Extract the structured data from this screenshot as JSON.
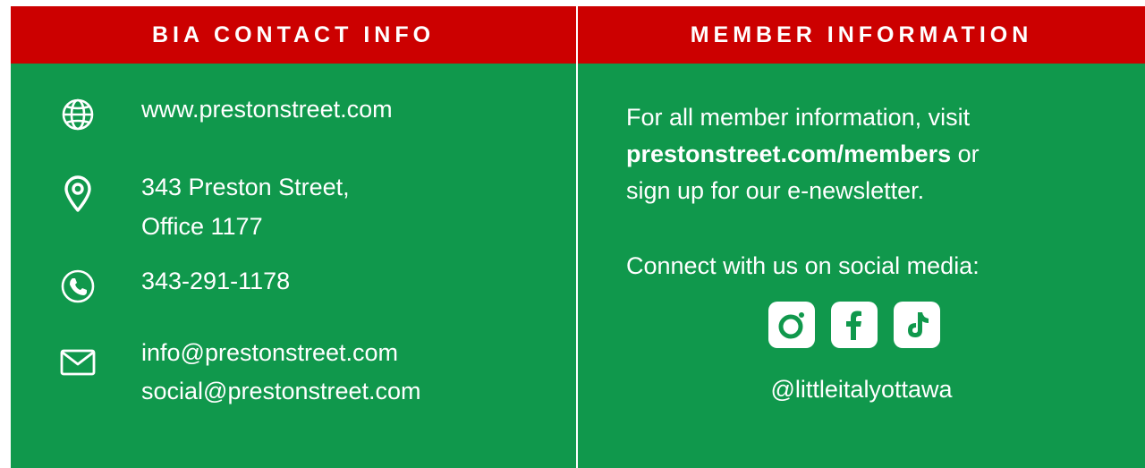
{
  "colors": {
    "header_red": "#cc0000",
    "panel_green": "#10984c",
    "text": "#ffffff"
  },
  "contact": {
    "title": "BIA CONTACT INFO",
    "website": {
      "icon": "globe-icon",
      "text": "www.prestonstreet.com"
    },
    "address": {
      "icon": "location-pin-icon",
      "line1": "343 Preston Street,",
      "line2": "Office 1177"
    },
    "phone": {
      "icon": "phone-icon",
      "text": "343-291-1178"
    },
    "email": {
      "icon": "envelope-icon",
      "line1": "info@prestonstreet.com",
      "line2": "social@prestonstreet.com"
    }
  },
  "member": {
    "title": "MEMBER INFORMATION",
    "line1": "For all member information, visit",
    "link": "prestonstreet.com/members",
    "line2_suffix": " or",
    "line3": "sign up for our e-newsletter.",
    "connect": "Connect with us on social media:",
    "social": [
      {
        "name": "instagram-icon"
      },
      {
        "name": "facebook-icon"
      },
      {
        "name": "tiktok-icon"
      }
    ],
    "handle": "@littleitalyottawa"
  }
}
